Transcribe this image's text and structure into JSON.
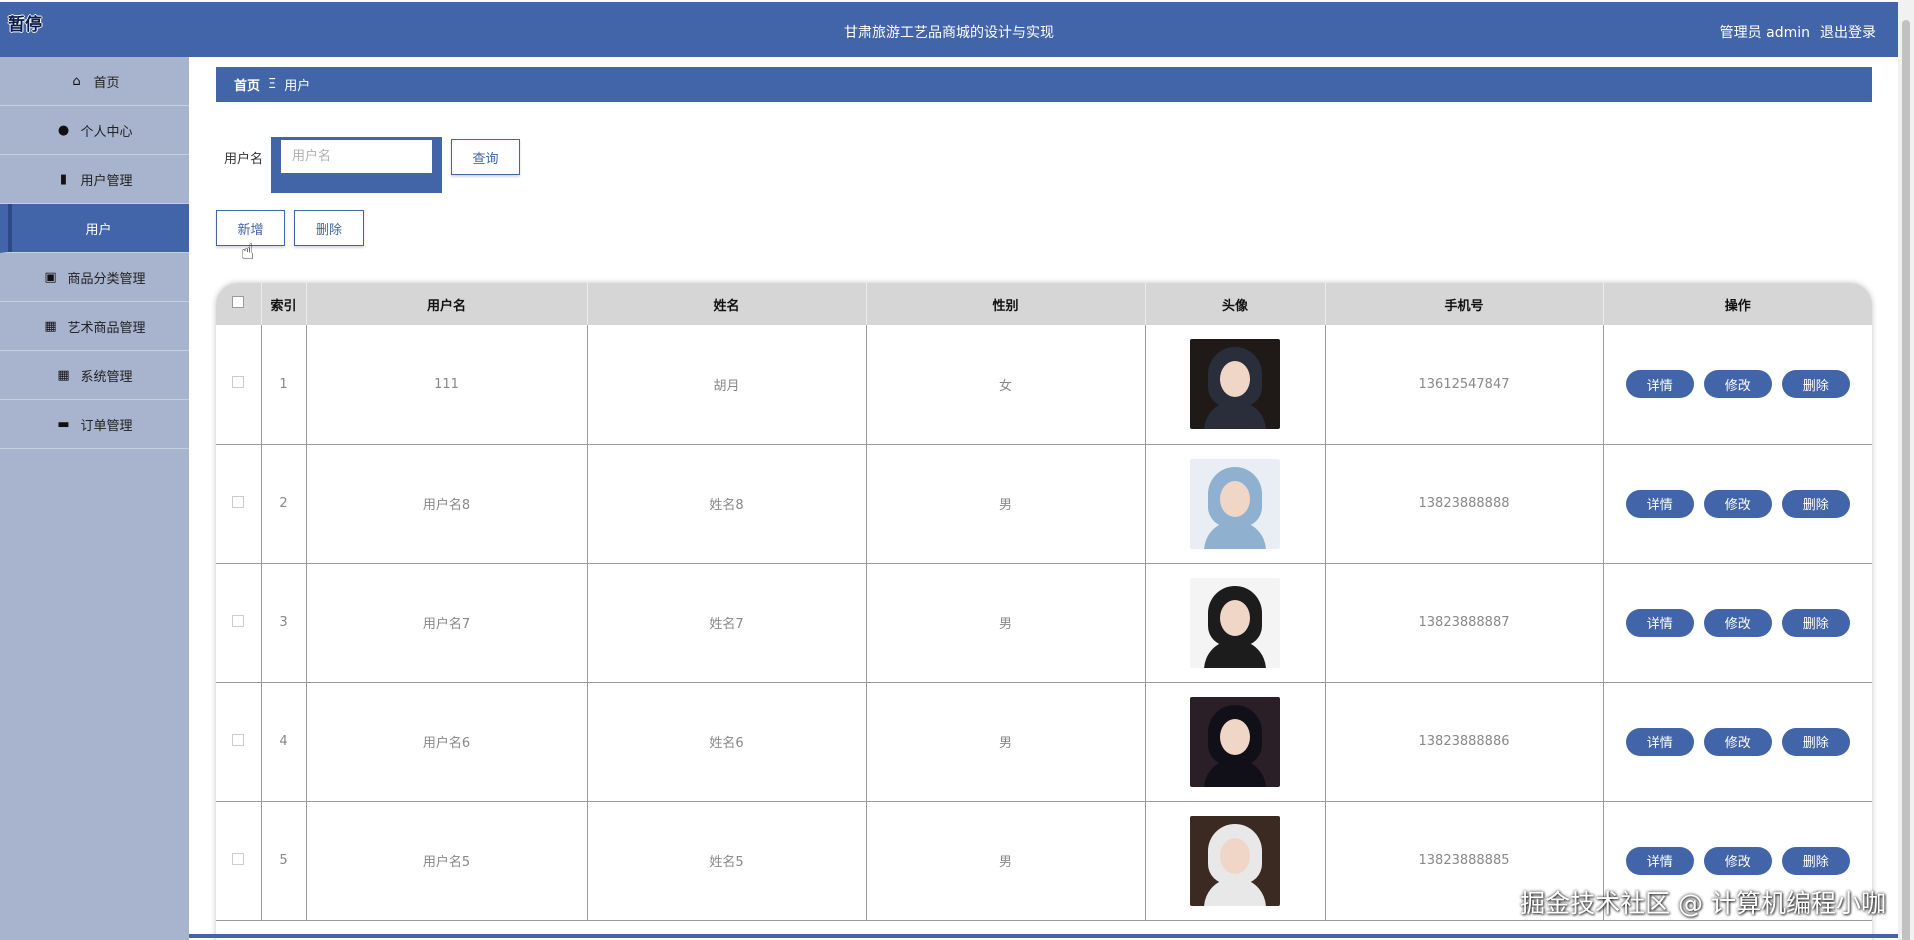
{
  "header": {
    "paused_label": "暂停",
    "app_title": "甘肃旅游工艺品商城的设计与实现",
    "user_label": "管理员 admin",
    "logout_label": "退出登录"
  },
  "sidebar": {
    "items": [
      {
        "label": "首页",
        "icon": "home-icon"
      },
      {
        "label": "个人中心",
        "icon": "user-icon"
      },
      {
        "label": "用户管理",
        "icon": "clipboard-icon"
      },
      {
        "label": "用户",
        "icon": ""
      },
      {
        "label": "商品分类管理",
        "icon": "briefcase-icon"
      },
      {
        "label": "艺术商品管理",
        "icon": "grid-icon"
      },
      {
        "label": "系统管理",
        "icon": "apps-icon"
      },
      {
        "label": "订单管理",
        "icon": "monitor-icon"
      }
    ]
  },
  "breadcrumb": {
    "home": "首页",
    "separator": "Ξ",
    "current": "用户"
  },
  "search": {
    "label": "用户名",
    "placeholder": "用户名",
    "value": "",
    "query_button": "查询"
  },
  "toolbar": {
    "add_label": "新增",
    "delete_label": "删除"
  },
  "table": {
    "headers": [
      "",
      "索引",
      "用户名",
      "姓名",
      "性别",
      "头像",
      "手机号",
      "操作"
    ],
    "action_labels": {
      "detail": "详情",
      "edit": "修改",
      "delete": "删除"
    },
    "rows": [
      {
        "index": "1",
        "username": "111",
        "name": "胡月",
        "gender": "女",
        "phone": "13612547847",
        "avatar_colors": [
          "#1f1a18",
          "#2a2d3a"
        ]
      },
      {
        "index": "2",
        "username": "用户名8",
        "name": "姓名8",
        "gender": "男",
        "phone": "13823888888",
        "avatar_colors": [
          "#e9eef4",
          "#8fb0cf"
        ]
      },
      {
        "index": "3",
        "username": "用户名7",
        "name": "姓名7",
        "gender": "男",
        "phone": "13823888887",
        "avatar_colors": [
          "#f4f4f4",
          "#1c1c1c"
        ]
      },
      {
        "index": "4",
        "username": "用户名6",
        "name": "姓名6",
        "gender": "男",
        "phone": "13823888886",
        "avatar_colors": [
          "#2a1f26",
          "#111018"
        ]
      },
      {
        "index": "5",
        "username": "用户名5",
        "name": "姓名5",
        "gender": "男",
        "phone": "13823888885",
        "avatar_colors": [
          "#3b2a22",
          "#e8e8e8"
        ]
      }
    ]
  },
  "watermark": "掘金技术社区 @ 计算机编程小咖",
  "colors": {
    "accent": "#4264a8",
    "sidebar": "#a8b3ce",
    "header_row": "#d6d6d6"
  }
}
